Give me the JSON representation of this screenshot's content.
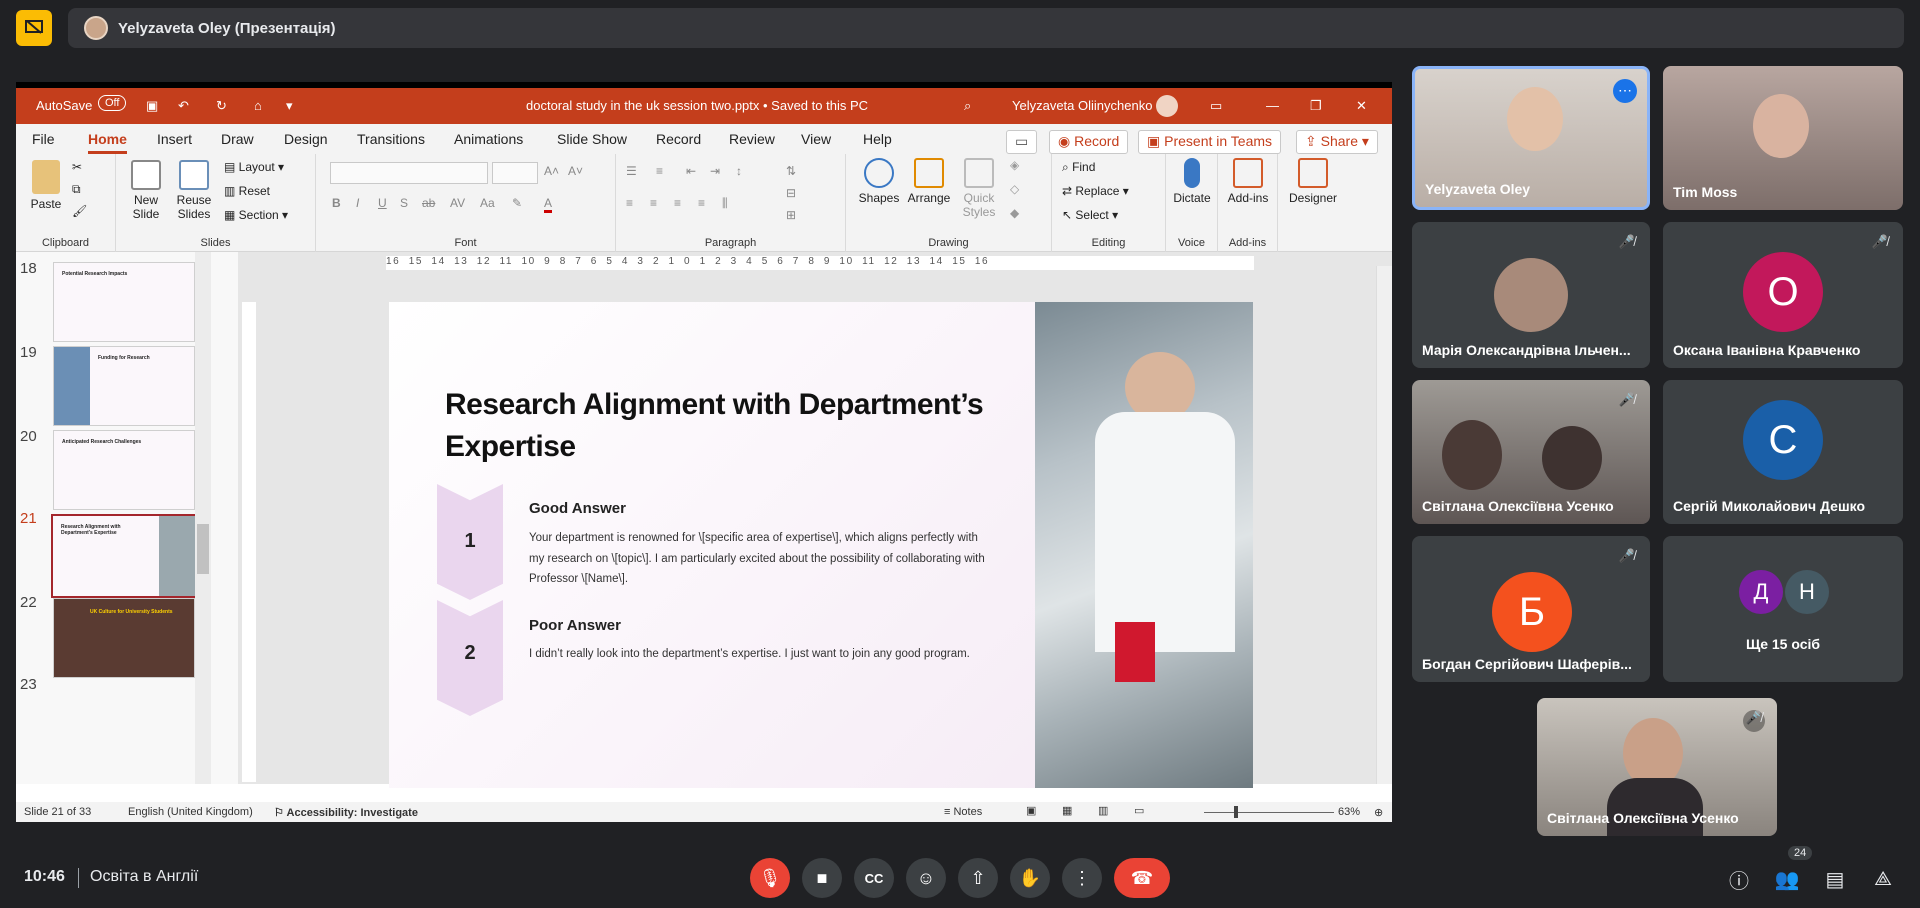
{
  "topbar": {
    "presenter": "Yelyzaveta Oley (Презентація)"
  },
  "ppt": {
    "autosave": "AutoSave",
    "autosave_state": "Off",
    "doc_title": "doctoral study in the uk session two.pptx • Saved to this PC",
    "user": "Yelyzaveta Oliinychenko",
    "tabs": [
      "File",
      "Home",
      "Insert",
      "Draw",
      "Design",
      "Transitions",
      "Animations",
      "Slide Show",
      "Record",
      "Review",
      "View",
      "Help"
    ],
    "record_btn": "Record",
    "teams_btn": "Present in Teams",
    "share_btn": "Share",
    "ribbon": {
      "paste": "Paste",
      "clipboard": "Clipboard",
      "new_slide": "New Slide",
      "reuse_slides": "Reuse Slides",
      "layout": "Layout",
      "reset": "Reset",
      "section": "Section",
      "slides": "Slides",
      "font": "Font",
      "paragraph": "Paragraph",
      "shapes": "Shapes",
      "arrange": "Arrange",
      "quick_styles": "Quick Styles",
      "drawing": "Drawing",
      "find": "Find",
      "replace": "Replace",
      "select": "Select",
      "editing": "Editing",
      "dictate": "Dictate",
      "voice": "Voice",
      "addins": "Add-ins",
      "addins_grp": "Add-ins",
      "designer": "Designer"
    },
    "ruler": "16 15 14 13 12 11 10 9 8 7 6 5 4 3 2 1 0 1 2 3 4 5 6 7 8 9 10 11 12 13 14 15 16",
    "thumbnails": [
      {
        "num": "18",
        "title": "Potential Research Impacts"
      },
      {
        "num": "19",
        "title": "Funding for Research"
      },
      {
        "num": "20",
        "title": "Anticipated Research Challenges"
      },
      {
        "num": "21",
        "title": "Research Alignment with Department's Expertise"
      },
      {
        "num": "22",
        "title": "UK Culture for University Students"
      },
      {
        "num": "23",
        "title": ""
      }
    ],
    "slide": {
      "title": "Research Alignment with Department’s Expertise",
      "items": [
        {
          "num": "1",
          "heading": "Good Answer",
          "body": "Your department is renowned for \\[specific area of expertise\\], which aligns perfectly with my research on \\[topic\\]. I am particularly excited about the possibility of collaborating with Professor \\[Name\\]."
        },
        {
          "num": "2",
          "heading": "Poor Answer",
          "body": "I didn’t really look into the department’s expertise. I just want to join any good program."
        }
      ]
    },
    "status": {
      "slide_count": "Slide 21 of 33",
      "language": "English (United Kingdom)",
      "accessibility": "Accessibility: Investigate",
      "notes": "Notes",
      "zoom": "63%"
    }
  },
  "participants": [
    {
      "name": "Yelyzaveta Oley"
    },
    {
      "name": "Tim Moss"
    },
    {
      "name": "Марія Олександрівна Ільчен..."
    },
    {
      "name": "Оксана Іванівна Кравченко",
      "letter": "О",
      "color": "#c2185b"
    },
    {
      "name": "Світлана Олексіївна Усенко"
    },
    {
      "name": "Сергій Миколайович Дешко",
      "letter": "С",
      "color": "#1a5fa8"
    },
    {
      "name": "Богдан Сергійович Шаферів...",
      "letter": "Б",
      "color": "#f4511e"
    },
    {
      "name": "Ще 15 осіб",
      "letters": [
        "Д",
        "Н"
      ]
    },
    {
      "name": "Світлана Олексіївна Усенко"
    }
  ],
  "bottom": {
    "time": "10:46",
    "meeting": "Освіта в Англії",
    "people_count": "24"
  }
}
